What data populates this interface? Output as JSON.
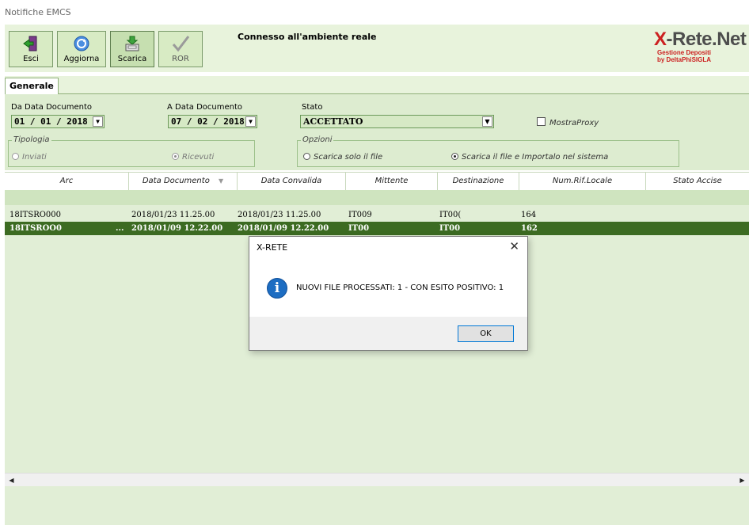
{
  "window": {
    "title": "Notifiche EMCS"
  },
  "toolbar": {
    "buttons": [
      {
        "label": "Esci",
        "icon": "exit-door-icon"
      },
      {
        "label": "Aggiorna",
        "icon": "refresh-icon"
      },
      {
        "label": "Scarica",
        "icon": "download-tray-icon"
      },
      {
        "label": "ROR",
        "icon": "checkmark-icon"
      }
    ],
    "connection_status": "Connesso all'ambiente reale"
  },
  "logo": {
    "name_x": "X",
    "name_rest": "-Rete.Net",
    "line1": "Gestione Depositi",
    "line2": "by DeltaPhiSIGLA"
  },
  "tabs": [
    {
      "label": "Generale",
      "active": true
    }
  ],
  "filters": {
    "from_date_label": "Da Data Documento",
    "from_date_value": "01 / 01 / 2018",
    "to_date_label": "A Data Documento",
    "to_date_value": "07 / 02 / 2018",
    "status_label": "Stato",
    "status_value": "ACCETTATO",
    "mostra_proxy_label": "MostraProxy",
    "mostra_proxy_checked": false,
    "tipologia": {
      "title": "Tipologia",
      "options": [
        {
          "label": "Inviati",
          "selected": false
        },
        {
          "label": "Ricevuti",
          "selected": true
        }
      ]
    },
    "opzioni": {
      "title": "Opzioni",
      "options": [
        {
          "label": "Scarica solo il file",
          "selected": false
        },
        {
          "label": "Scarica il file e Importalo nel sistema",
          "selected": true
        }
      ]
    }
  },
  "grid": {
    "columns": [
      "Arc",
      "Data Documento",
      "Data Convalida",
      "Mittente",
      "Destinazione",
      "Num.Rif.Locale",
      "Stato Accise"
    ],
    "rows": [
      {
        "arc": "18ITSRO000",
        "data_documento": "2018/01/23 11.25.00",
        "data_convalida": "2018/01/23 11.25.00",
        "mittente": "IT009",
        "destinazione": "IT00(",
        "num_rif_locale": "164",
        "selected": false
      },
      {
        "arc": "18ITSROO0",
        "arc_more": "...",
        "data_documento": "2018/01/09 12.22.00",
        "data_convalida": "2018/01/09 12.22.00",
        "mittente": "IT00",
        "destinazione": "IT00",
        "num_rif_locale": "162",
        "selected": true
      }
    ]
  },
  "dialog": {
    "title": "X-RETE",
    "close_glyph": "✕",
    "icon": "info-icon",
    "info_glyph": "i",
    "message": "NUOVI FILE PROCESSATI: 1 -  CON ESITO POSITIVO: 1",
    "ok_label": "OK"
  },
  "colors": {
    "toolbar_bg": "#e8f3dc",
    "panel_bg": "#ddecd0",
    "grid_bg": "#e1eed6",
    "selected_row": "#3c6b22",
    "logo_red": "#cc2020"
  }
}
